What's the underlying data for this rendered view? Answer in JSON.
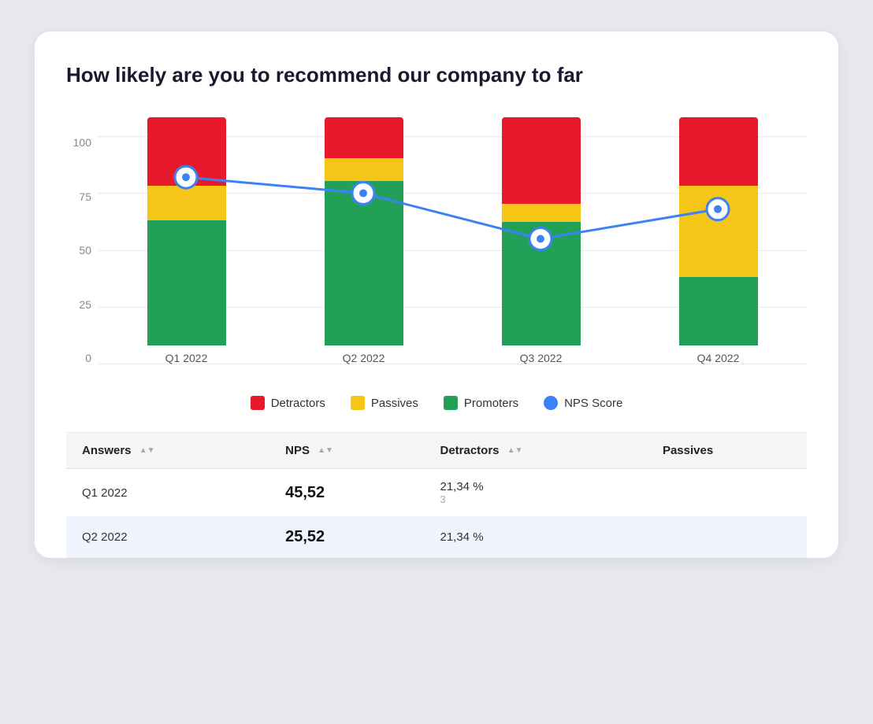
{
  "title": "How likely are you to recommend our company to far",
  "chart": {
    "yLabels": [
      "0",
      "25",
      "50",
      "75",
      "100"
    ],
    "bars": [
      {
        "label": "Q1 2022",
        "detractors": 30,
        "passives": 15,
        "promoters": 55,
        "npsScore": 82
      },
      {
        "label": "Q2 2022",
        "detractors": 18,
        "passives": 10,
        "promoters": 72,
        "npsScore": 75
      },
      {
        "label": "Q3 2022",
        "detractors": 38,
        "passives": 8,
        "promoters": 54,
        "npsScore": 55
      },
      {
        "label": "Q4 2022",
        "detractors": 30,
        "passives": 40,
        "promoters": 30,
        "npsScore": 68
      }
    ]
  },
  "legend": {
    "detractors_label": "Detractors",
    "passives_label": "Passives",
    "promoters_label": "Promoters",
    "nps_label": "NPS Score"
  },
  "colors": {
    "detractors": "#e8192c",
    "passives": "#f5c518",
    "promoters": "#22a057",
    "nps_line": "#3b82f6"
  },
  "table": {
    "headers": [
      "Answers",
      "NPS",
      "Detractors",
      "Passives"
    ],
    "rows": [
      {
        "answer": "Q1 2022",
        "nps": "45,52",
        "detractors_pct": "21,34 %",
        "detractors_count": "3",
        "passives_pct": "",
        "highlighted": false
      },
      {
        "answer": "Q2 2022",
        "nps": "25,52",
        "detractors_pct": "21,34 %",
        "detractors_count": "",
        "passives_pct": "",
        "highlighted": true
      }
    ]
  }
}
